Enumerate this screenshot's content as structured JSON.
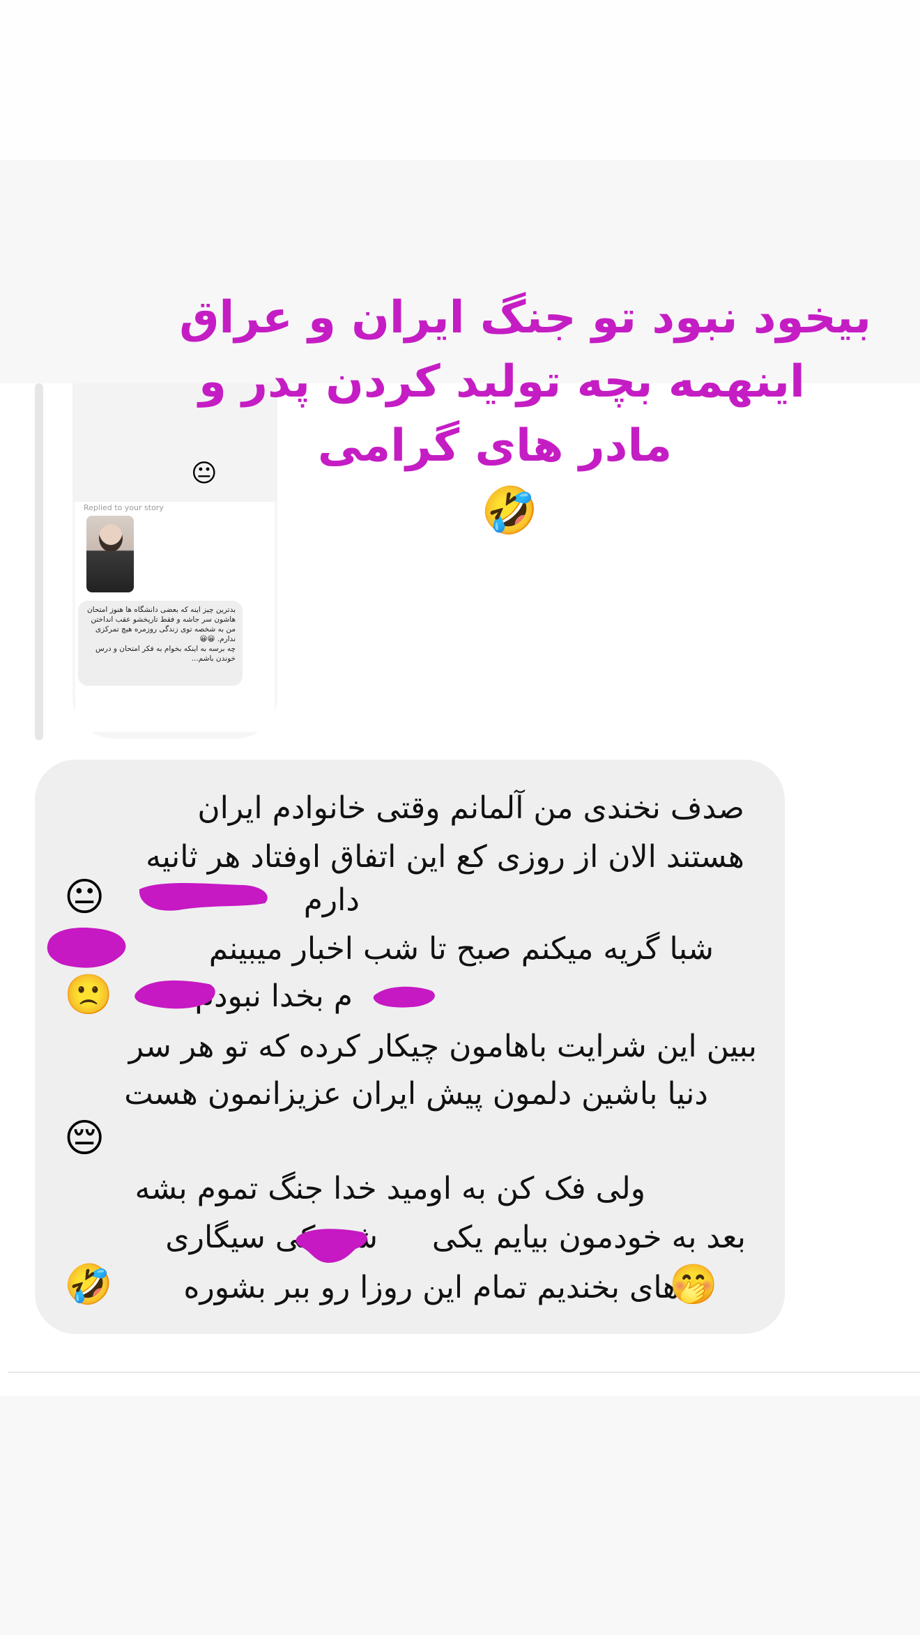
{
  "headline": {
    "line1": "بیخود نبود تو جنگ ایران و عراق",
    "line2": "اینهمه بچه تولید کردن پدر و",
    "line3": "مادر های گرامی",
    "emoji": "🤣"
  },
  "story_reply": {
    "top_emoji": "😐",
    "replied_label": "Replied to your story",
    "mini_message": "بدترین چیز اینه که بعضی دانشگاه ها هنوز امتحان هاشون سر جاشه و فقط تاریخشو عقب انداختن\nمن به شخصه توی زندگی روزمره هیچ تمرکزی ندارم. 😀😀\nچه برسه به اینکه بخوام به فکر امتحان و درس خوندن باشم..."
  },
  "message": {
    "line1": "صدف نخندی من آلمانم وقتی خانوادم ایران",
    "line2": "هستند الان از روزی کع این اتفاق اوفتاد هر ثانیه",
    "line3": "دارم",
    "line3_emoji": "😐",
    "line4": "شبا گریه میکنم صبح تا شب اخبار میبینم",
    "line5": "م بخدا نبودم",
    "line5_emoji": "🙁",
    "line6": "ببین این شرایت باهامون چیکار کرده که تو هر سر",
    "line7": "دنیا باشین دلمون پیش ایران عزیزانمون هست",
    "line8_emoji": "😔",
    "line9": "ولی فک کن به اومید خدا جنگ تموم بشه",
    "line10_right": "بعد به خودمون بیایم یکی",
    "line10_left": "شد یکی سیگاری",
    "line11": "های بخندیم تمام این روزا رو ببر بشوره",
    "line11_emoji_a": "🤭",
    "line11_emoji_b": "🤣"
  },
  "colors": {
    "headline": "#c51dc4",
    "scribble": "#c618c3",
    "bubble": "#efefef"
  }
}
